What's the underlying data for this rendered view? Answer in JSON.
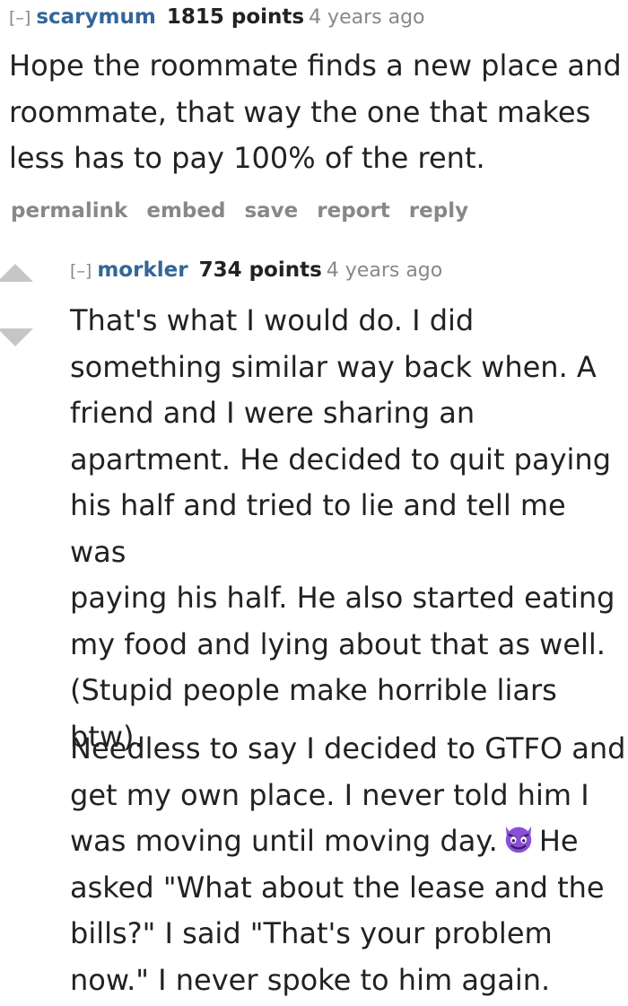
{
  "parent_comment": {
    "collapse_toggle": "[–]",
    "author": "scarymum",
    "score": "1815 points",
    "age": "4 years ago",
    "body_lines": [
      "Hope the roommate finds a new place and",
      "roommate, that way the one that makes",
      "less has to pay 100% of the rent."
    ],
    "actions": [
      "permalink",
      "embed",
      "save",
      "report",
      "reply"
    ]
  },
  "child_comment": {
    "collapse_toggle": "[–]",
    "author": "morkler",
    "score": "734 points",
    "age": "4 years ago",
    "paragraph1_lines": [
      "That's what I would do. I did",
      "something similar way back when. A",
      "friend and I were sharing an",
      "apartment. He decided to quit paying",
      "his half and tried to lie and tell me was",
      "paying his half. He also started eating",
      "my food and lying about that as well.",
      "(Stupid people make horrible liars",
      "btw)."
    ],
    "paragraph2_lines": [
      "Needless to say I decided to GTFO and",
      "get my own place. I never told him I",
      "was moving until moving day."
    ],
    "paragraph2_after_emoji": "He",
    "paragraph2_rest_lines": [
      "asked \"What about the lease and the",
      "bills?\" I said \"That's your problem",
      "now.\" I never spoke to him again."
    ],
    "emoji_icon": "smiling-devil-icon"
  },
  "colors": {
    "author_link": "#336699",
    "muted": "#888888",
    "vote_arrow": "#c6c6c6",
    "emoji": "#8a4fd8"
  }
}
